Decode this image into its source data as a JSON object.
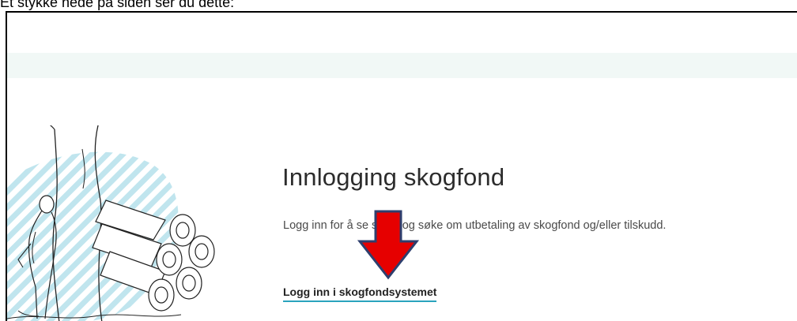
{
  "caption": "Et stykke nede på siden ser du dette:",
  "page": {
    "title": "Innlogging skogfond",
    "intro": "Logg inn for å se saldo og søke om utbetaling av skogfond og/eller tilskudd.",
    "login_link": "Logg inn i skogfondsystemet"
  },
  "colors": {
    "band": "#f1f8f6",
    "link_underline": "#2aa3bd",
    "arrow_fill": "#e60000",
    "arrow_stroke": "#2e3f6e",
    "hatch": "#b9e2ec"
  },
  "icons": {
    "illustration": "forest-logs-illustration",
    "arrow": "down-arrow-icon"
  }
}
